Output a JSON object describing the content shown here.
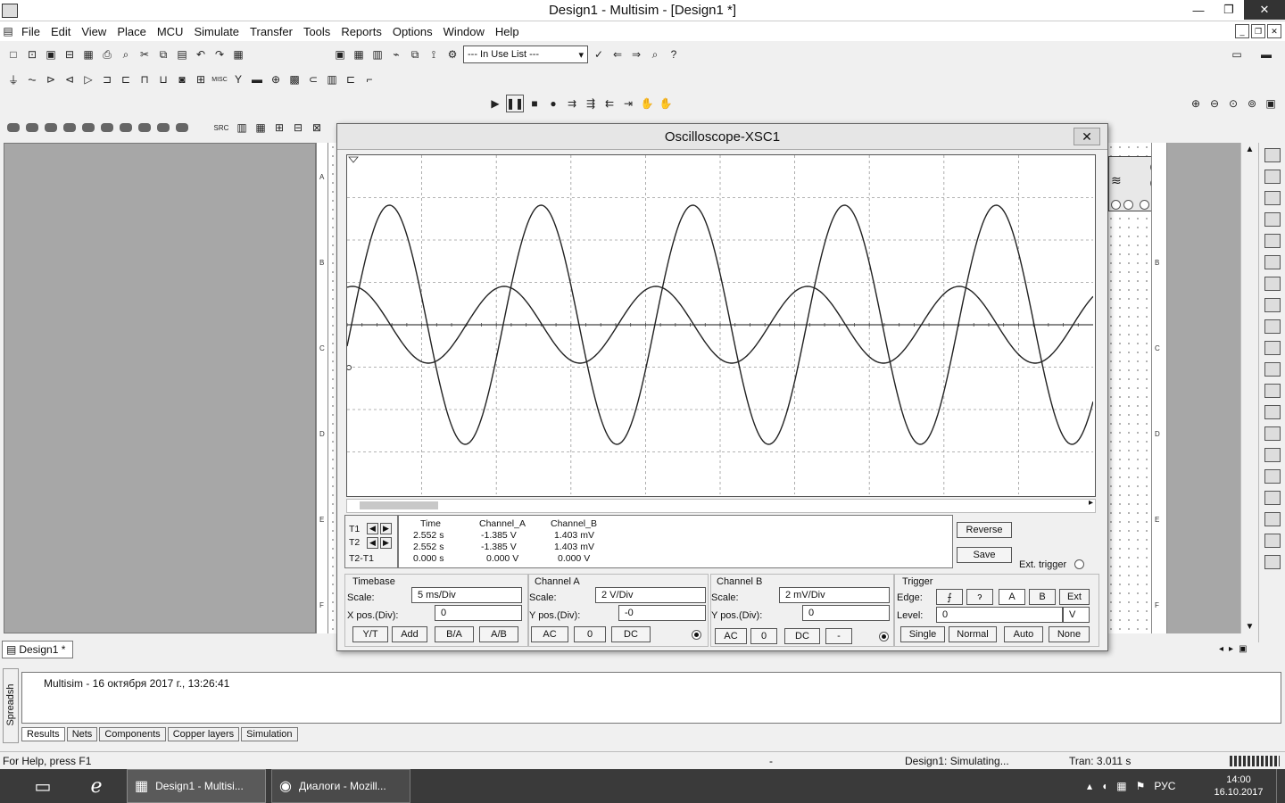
{
  "window": {
    "title": "Design1 - Multisim - [Design1 *]",
    "min": "—",
    "max": "❐",
    "close": "✕"
  },
  "menu": [
    "File",
    "Edit",
    "View",
    "Place",
    "MCU",
    "Simulate",
    "Transfer",
    "Tools",
    "Reports",
    "Options",
    "Window",
    "Help"
  ],
  "toolbar": {
    "in_use_list": "--- In Use List ---",
    "help_glyph": "?"
  },
  "toolbar_misc": {
    "src": "SRC",
    "misc": "MISC"
  },
  "ruler_letters": [
    "A",
    "B",
    "C",
    "D",
    "E",
    "F"
  ],
  "oscilloscope": {
    "title": "Oscilloscope-XSC1",
    "close": "✕",
    "readout": {
      "headers": [
        "Time",
        "Channel_A",
        "Channel_B"
      ],
      "rows": [
        {
          "label": "T1",
          "time": "2.552 s",
          "a": "-1.385 V",
          "b": "1.403 mV"
        },
        {
          "label": "T2",
          "time": "2.552 s",
          "a": "-1.385 V",
          "b": "1.403 mV"
        },
        {
          "label": "T2-T1",
          "time": "0.000 s",
          "a": "0.000 V",
          "b": "0.000 V"
        }
      ]
    },
    "buttons": {
      "reverse": "Reverse",
      "save": "Save",
      "ext_trigger": "Ext. trigger"
    },
    "timebase": {
      "title": "Timebase",
      "scale_label": "Scale:",
      "scale": "5 ms/Div",
      "xpos_label": "X pos.(Div):",
      "xpos": "0",
      "modes": [
        "Y/T",
        "Add",
        "B/A",
        "A/B"
      ]
    },
    "channel_a": {
      "title": "Channel A",
      "scale_label": "Scale:",
      "scale": "2  V/Div",
      "ypos_label": "Y pos.(Div):",
      "ypos": "-0",
      "coupling": [
        "AC",
        "0",
        "DC"
      ]
    },
    "channel_b": {
      "title": "Channel B",
      "scale_label": "Scale:",
      "scale": "2 mV/Div",
      "ypos_label": "Y pos.(Div):",
      "ypos": "0",
      "coupling": [
        "AC",
        "0",
        "DC",
        "-"
      ]
    },
    "trigger": {
      "title": "Trigger",
      "edge_label": "Edge:",
      "edge_rise": "⨍",
      "edge_fall": "ɂ",
      "sources": [
        "A",
        "B",
        "Ext"
      ],
      "level_label": "Level:",
      "level": "0",
      "level_unit": "V",
      "modes": [
        "Single",
        "Normal",
        "Auto",
        "None"
      ]
    }
  },
  "design_tab": "Design1 *",
  "results": {
    "text": "Multisim  -  16 октября 2017 г., 13:26:41",
    "side_label": "Spreadsh",
    "tabs": [
      "Results",
      "Nets",
      "Components",
      "Copper layers",
      "Simulation"
    ]
  },
  "status": {
    "help": "For Help, press F1",
    "dash": "-",
    "state": "Design1: Simulating...",
    "tran": "Tran: 3.011 s"
  },
  "taskbar": {
    "item1": "Design1 - Multisi...",
    "item2": "Диалоги - Mozill...",
    "lang": "РУС",
    "time": "14:00",
    "date": "16.10.2017"
  },
  "colors": {
    "trace": "#222222",
    "grid": "#9a9a9a",
    "panel": "#f0f0f0",
    "taskbar": "#3a3a3a"
  }
}
